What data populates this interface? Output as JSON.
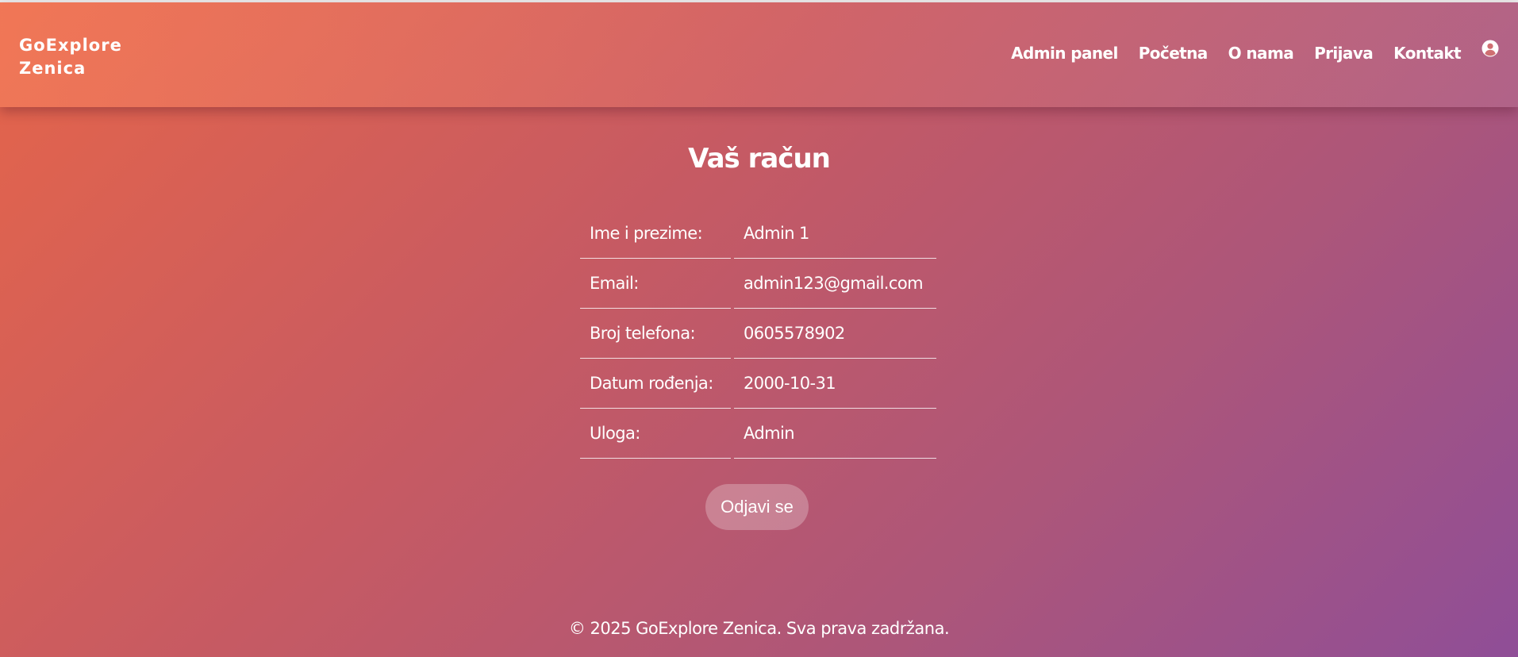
{
  "header": {
    "brand_line1": "GoExplore",
    "brand_line2": "Zenica",
    "nav": [
      {
        "label": "Admin panel"
      },
      {
        "label": "Početna"
      },
      {
        "label": "O nama"
      },
      {
        "label": "Prijava"
      },
      {
        "label": "Kontakt"
      }
    ],
    "account_icon": "user-circle-icon"
  },
  "main": {
    "title": "Vaš račun",
    "rows": [
      {
        "label": "Ime i prezime:",
        "value": "Admin 1"
      },
      {
        "label": "Email:",
        "value": "admin123@gmail.com"
      },
      {
        "label": "Broj telefona:",
        "value": "0605578902"
      },
      {
        "label": "Datum rođenja:",
        "value": "2000-10-31"
      },
      {
        "label": "Uloga:",
        "value": "Admin"
      }
    ],
    "logout_label": "Odjavi se"
  },
  "footer": {
    "text": "© 2025 GoExplore Zenica. Sva prava zadržana."
  },
  "colors": {
    "gradient_start": "#e5654a",
    "gradient_end": "#8f4e97",
    "text": "#ffffff"
  }
}
